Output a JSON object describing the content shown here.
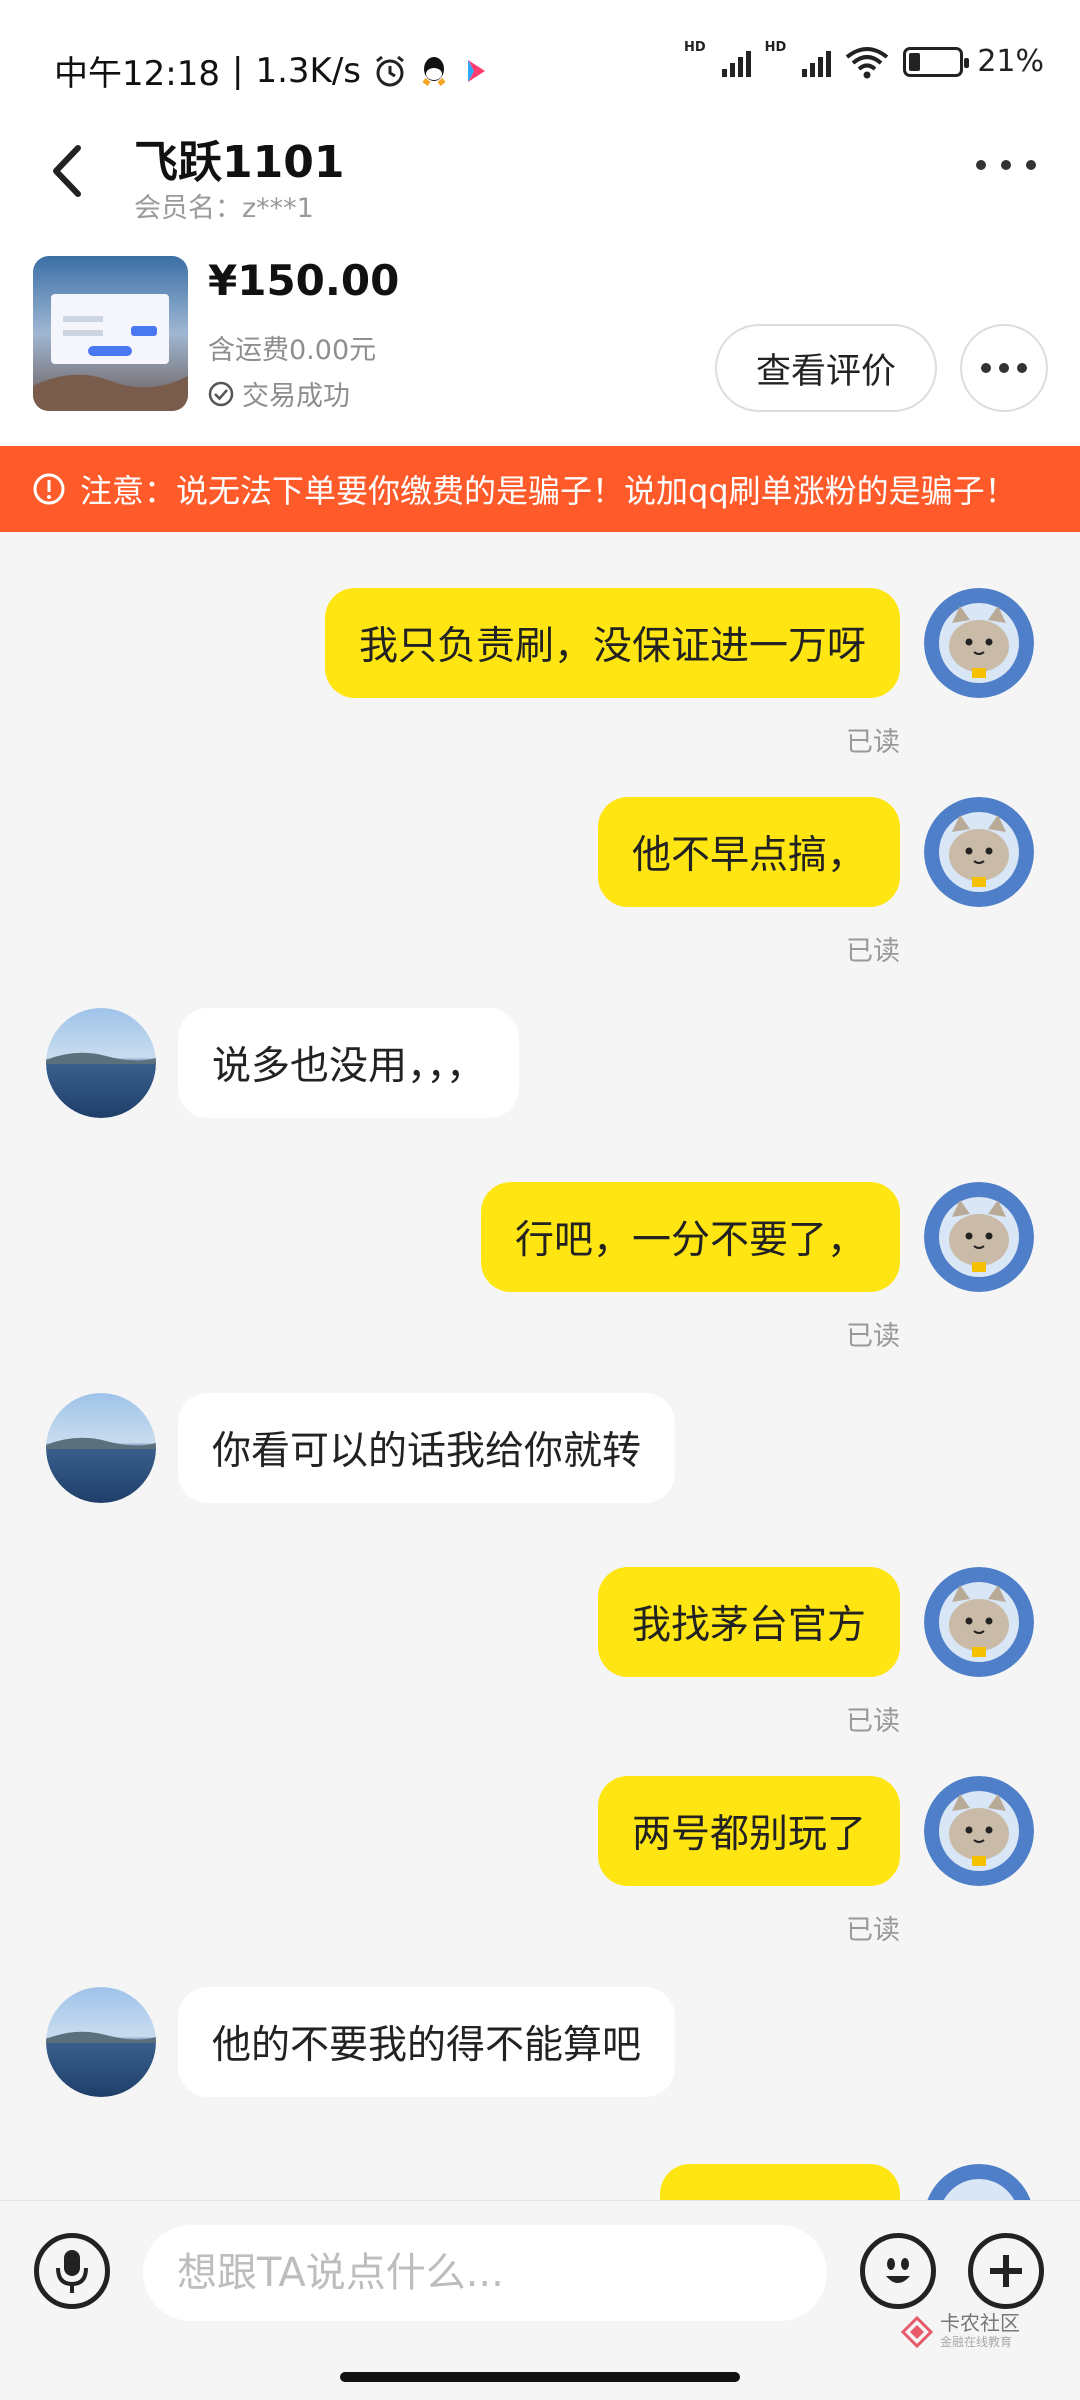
{
  "status_bar": {
    "time": "中午12:18",
    "speed": "1.3K/s",
    "battery": "21%",
    "battery_level": 0.21,
    "hd1": "HD",
    "hd2": "HD"
  },
  "header": {
    "title": "飞跃1101",
    "subtitle": "会员名：z***1"
  },
  "order": {
    "price": "¥150.00",
    "shipping": "含运费0.00元",
    "status": "交易成功",
    "review_button": "查看评价"
  },
  "warning": {
    "text": "注意：说无法下单要你缴费的是骗子！说加qq刷单涨粉的是骗子！"
  },
  "messages": [
    {
      "from": "me",
      "text": "我只负责刷，没保证进一万呀",
      "read": "已读"
    },
    {
      "from": "me",
      "text": "他不早点搞，",
      "read": "已读"
    },
    {
      "from": "them",
      "text": "说多也没用，，，"
    },
    {
      "from": "me",
      "text": "行吧，一分不要了，",
      "read": "已读"
    },
    {
      "from": "them",
      "text": "你看可以的话我给你就转"
    },
    {
      "from": "me",
      "text": "我找茅台官方",
      "read": "已读"
    },
    {
      "from": "me",
      "text": "两号都别玩了",
      "read": "已读"
    },
    {
      "from": "them",
      "text": "他的不要我的得不能算吧"
    }
  ],
  "input": {
    "placeholder": "想跟TA说点什么..."
  },
  "watermark": {
    "text": "卡农社区",
    "sub": "金融在线教育"
  },
  "colors": {
    "my_bubble": "#ffe511",
    "warning_bg": "#ff5b2a"
  }
}
